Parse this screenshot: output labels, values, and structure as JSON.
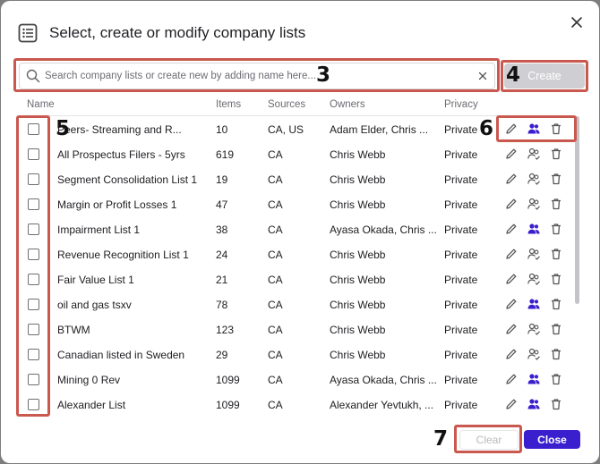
{
  "dialog": {
    "title": "Select, create or modify company lists",
    "title_icon": "list-icon",
    "close_icon": "close-icon"
  },
  "search": {
    "placeholder": "Search company lists or create new by adding name here...",
    "value": "",
    "clear_symbol": "×"
  },
  "create_button": {
    "label": "Create"
  },
  "table": {
    "columns": [
      "Name",
      "Items",
      "Sources",
      "Owners",
      "Privacy"
    ],
    "rows": [
      {
        "name": "Peers- Streaming and R...",
        "items": "10",
        "sources": "CA, US",
        "owners": "Adam Elder, Chris ...",
        "privacy": "Private",
        "shared": true
      },
      {
        "name": "All Prospectus Filers - 5yrs",
        "items": "619",
        "sources": "CA",
        "owners": "Chris Webb",
        "privacy": "Private",
        "shared": false
      },
      {
        "name": "Segment Consolidation List 1",
        "items": "19",
        "sources": "CA",
        "owners": "Chris Webb",
        "privacy": "Private",
        "shared": false
      },
      {
        "name": "Margin or Profit Losses 1",
        "items": "47",
        "sources": "CA",
        "owners": "Chris Webb",
        "privacy": "Private",
        "shared": false
      },
      {
        "name": "Impairment List 1",
        "items": "38",
        "sources": "CA",
        "owners": "Ayasa Okada, Chris ...",
        "privacy": "Private",
        "shared": true
      },
      {
        "name": "Revenue Recognition List 1",
        "items": "24",
        "sources": "CA",
        "owners": "Chris Webb",
        "privacy": "Private",
        "shared": false
      },
      {
        "name": "Fair Value List 1",
        "items": "21",
        "sources": "CA",
        "owners": "Chris Webb",
        "privacy": "Private",
        "shared": false
      },
      {
        "name": "oil and gas tsxv",
        "items": "78",
        "sources": "CA",
        "owners": "Chris Webb",
        "privacy": "Private",
        "shared": true
      },
      {
        "name": "BTWM",
        "items": "123",
        "sources": "CA",
        "owners": "Chris Webb",
        "privacy": "Private",
        "shared": false
      },
      {
        "name": "Canadian listed in Sweden",
        "items": "29",
        "sources": "CA",
        "owners": "Chris Webb",
        "privacy": "Private",
        "shared": false
      },
      {
        "name": "Mining 0 Rev",
        "items": "1099",
        "sources": "CA",
        "owners": "Ayasa Okada, Chris ...",
        "privacy": "Private",
        "shared": true
      },
      {
        "name": "Alexander List",
        "items": "1099",
        "sources": "CA",
        "owners": "Alexander Yevtukh, ...",
        "privacy": "Private",
        "shared": true
      }
    ]
  },
  "footer": {
    "clear_label": "Clear",
    "close_label": "Close"
  },
  "annotations": [
    "3",
    "4",
    "5",
    "6",
    "7"
  ],
  "colors": {
    "accent": "#3a1fce",
    "highlight_box": "#c9584f",
    "disabled_button": "#cfcfd3"
  }
}
